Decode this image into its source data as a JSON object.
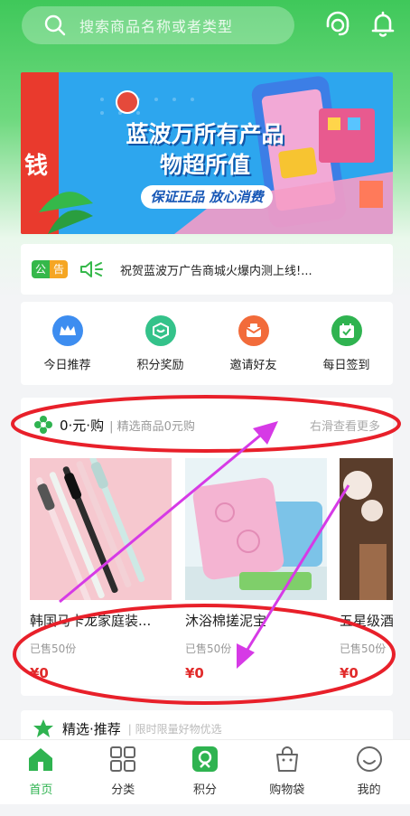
{
  "header": {
    "search_placeholder": "搜索商品名称或者类型",
    "icons": [
      "search-icon",
      "headset-icon",
      "bell-icon"
    ]
  },
  "banner": {
    "line1": "蓝波万所有产品",
    "line2": "物超所值",
    "tagline": "保证正品 放心消费",
    "edge_text": "钱"
  },
  "notice": {
    "tag_left": "公",
    "tag_right": "告",
    "text": "祝贺蓝波万广告商城火爆内测上线!..."
  },
  "quick_menu": [
    {
      "label": "今日推荐",
      "icon": "crown-icon",
      "color": "#3d8df0"
    },
    {
      "label": "积分奖励",
      "icon": "gift-icon",
      "color": "#34c28a"
    },
    {
      "label": "邀请好友",
      "icon": "envelope-icon",
      "color": "#f26b3a"
    },
    {
      "label": "每日签到",
      "icon": "calendar-check-icon",
      "color": "#2fb350"
    }
  ],
  "zero_buy": {
    "title": "0·元·购",
    "subtitle": "| 精选商品0元购",
    "more": "右滑查看更多",
    "products": [
      {
        "name": "韩国马卡龙家庭装...",
        "sold": "已售50份",
        "price": "¥0"
      },
      {
        "name": "沐浴棉搓泥宝",
        "sold": "已售50份",
        "price": "¥0"
      },
      {
        "name": "五星级酒",
        "sold": "已售50份",
        "price": "¥0"
      }
    ]
  },
  "choice": {
    "title": "精选·推荐",
    "subtitle": "| 限时限量好物优选"
  },
  "tabbar": [
    {
      "label": "首页",
      "icon": "home-icon",
      "active": true
    },
    {
      "label": "分类",
      "icon": "grid-icon",
      "active": false
    },
    {
      "label": "积分",
      "icon": "points-icon",
      "active": false
    },
    {
      "label": "购物袋",
      "icon": "shopping-bag-icon",
      "active": false
    },
    {
      "label": "我的",
      "icon": "smile-icon",
      "active": false
    }
  ],
  "colors": {
    "brand_green": "#3fc85a",
    "price_red": "#e12b2b",
    "annotation": "#e8202a",
    "arrow": "#d63ae6"
  }
}
